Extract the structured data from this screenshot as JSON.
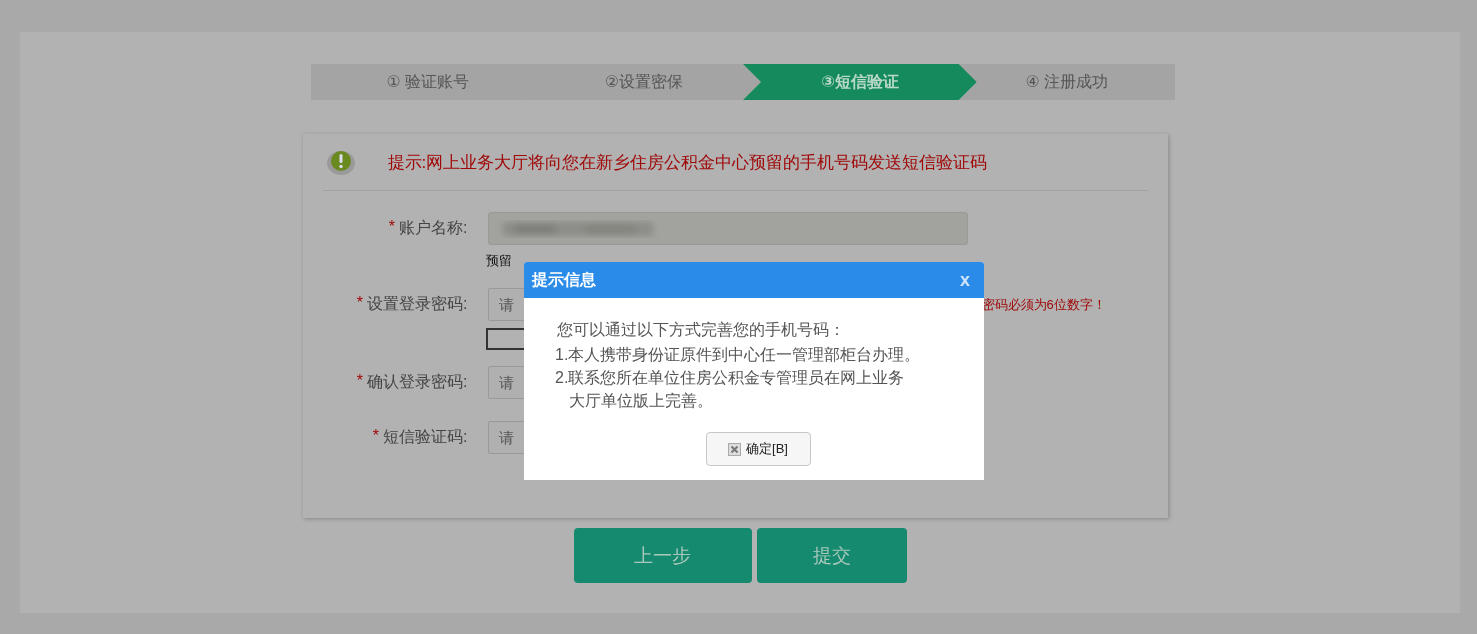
{
  "steps": [
    {
      "label": "① 验证账号",
      "selected": false
    },
    {
      "label": "②设置密保",
      "selected": false
    },
    {
      "label": "③短信验证",
      "selected": true
    },
    {
      "label": "④ 注册成功",
      "selected": false
    }
  ],
  "hint": "提示:网上业务大厅将向您在新乡住房公积金中心预留的手机号码发送短信验证码",
  "form": {
    "rows": [
      {
        "kind": "readonly",
        "required": "*",
        "label": "账户名称:"
      },
      {
        "kind": "note",
        "text": "预留"
      },
      {
        "kind": "input",
        "required": "*",
        "label": "设置登录密码:",
        "placeholder": "请",
        "error": "密码必须为6位数字！"
      },
      {
        "kind": "meter"
      },
      {
        "kind": "input",
        "required": "*",
        "label": "确认登录密码:",
        "placeholder": "请"
      },
      {
        "kind": "input",
        "required": "*",
        "label": "短信验证码:",
        "placeholder": "请"
      }
    ]
  },
  "buttons": [
    "上一步",
    "提交"
  ],
  "dialog": {
    "title": "提示信息",
    "close": "x",
    "lines": [
      "您可以通过以下方式完善您的手机号码：",
      "1.本人携带身份证原件到中心任一管理部柜台办理。",
      "2.联系您所在单位住房公积金专管理员在网上业务",
      "大厅单位版上完善。"
    ],
    "ok": "确定[B]"
  }
}
